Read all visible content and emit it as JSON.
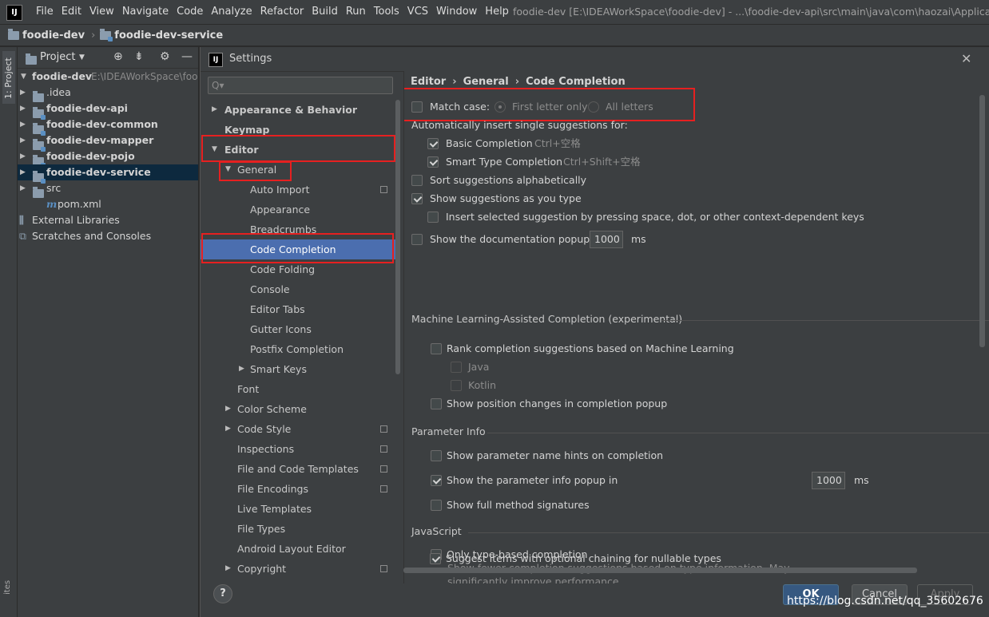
{
  "menubar": {
    "logo": "IJ",
    "items": [
      "File",
      "Edit",
      "View",
      "Navigate",
      "Code",
      "Analyze",
      "Refactor",
      "Build",
      "Run",
      "Tools",
      "VCS",
      "Window",
      "Help"
    ],
    "title": "foodie-dev [E:\\IDEAWorkSpace\\foodie-dev] - ...\\foodie-dev-api\\src\\main\\java\\com\\haozai\\Application"
  },
  "breadcrumb": [
    "foodie-dev",
    "foodie-dev-service"
  ],
  "toolstrip": {
    "project_tab": "1: Project",
    "bottom_tab": "ites"
  },
  "project_panel": {
    "title": "Project",
    "root": {
      "name": "foodie-dev",
      "path": "E:\\IDEAWorkSpace\\foo"
    },
    "items": [
      {
        "name": ".idea"
      },
      {
        "name": "foodie-dev-api"
      },
      {
        "name": "foodie-dev-common"
      },
      {
        "name": "foodie-dev-mapper"
      },
      {
        "name": "foodie-dev-pojo"
      },
      {
        "name": "foodie-dev-service"
      },
      {
        "name": "src"
      },
      {
        "name": "pom.xml"
      },
      {
        "name": "External Libraries"
      },
      {
        "name": "Scratches and Consoles"
      }
    ]
  },
  "dialog": {
    "title": "Settings",
    "logo": "IJ",
    "search_placeholder": "Q▾",
    "nav": {
      "appearance_behavior": "Appearance & Behavior",
      "keymap": "Keymap",
      "editor": "Editor",
      "general": "General",
      "general_children": [
        "Auto Import",
        "Appearance",
        "Breadcrumbs",
        "Code Completion",
        "Code Folding",
        "Console",
        "Editor Tabs",
        "Gutter Icons",
        "Postfix Completion",
        "Smart Keys"
      ],
      "editor_children": [
        "Font",
        "Color Scheme",
        "Code Style",
        "Inspections",
        "File and Code Templates",
        "File Encodings",
        "Live Templates",
        "File Types",
        "Android Layout Editor",
        "Copyright"
      ]
    },
    "path": [
      "Editor",
      "General",
      "Code Completion"
    ],
    "match_case": {
      "label": "Match case:",
      "first_letter": "First letter only",
      "all_letters": "All letters"
    },
    "auto_insert_header": "Automatically insert single suggestions for:",
    "basic_completion": {
      "label": "Basic Completion",
      "shortcut": "Ctrl+空格"
    },
    "smart_completion": {
      "label": "Smart Type Completion",
      "shortcut": "Ctrl+Shift+空格"
    },
    "sort_alpha": "Sort suggestions alphabetically",
    "show_as_type": "Show suggestions as you type",
    "insert_selected": "Insert selected suggestion by pressing space, dot, or other context-dependent keys",
    "doc_popup": {
      "label": "Show the documentation popup in",
      "value": "1000",
      "unit": "ms"
    },
    "ml_section": "Machine Learning-Assisted Completion (experimental)",
    "ml_rank": "Rank completion suggestions based on Machine Learning",
    "ml_java": "Java",
    "ml_kotlin": "Kotlin",
    "ml_position": "Show position changes in completion popup",
    "param_section": "Parameter Info",
    "param_hints": "Show parameter name hints on completion",
    "param_popup": {
      "label": "Show the parameter info popup in",
      "value": "1000",
      "unit": "ms"
    },
    "param_full": "Show full method signatures",
    "js_section": "JavaScript",
    "js_type_based": "Only type-based completion",
    "js_type_desc1": "Show fewer completion suggestions based on type information. May",
    "js_type_desc2": "significantly improve performance.",
    "js_optional_chain": "Suggest items with optional chaining for nullable types",
    "buttons": {
      "help": "?",
      "ok": "OK",
      "cancel": "Cancel",
      "apply": "Apply"
    }
  },
  "watermark": "https://blog.csdn.net/qq_35602676"
}
